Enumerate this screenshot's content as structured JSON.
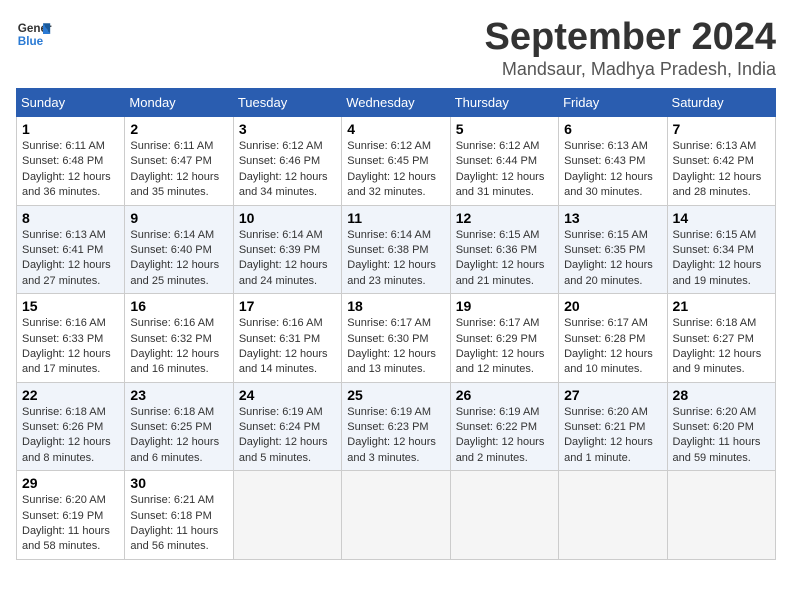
{
  "header": {
    "logo_line1": "General",
    "logo_line2": "Blue",
    "month_title": "September 2024",
    "location": "Mandsaur, Madhya Pradesh, India"
  },
  "weekdays": [
    "Sunday",
    "Monday",
    "Tuesday",
    "Wednesday",
    "Thursday",
    "Friday",
    "Saturday"
  ],
  "weeks": [
    [
      {
        "day": "1",
        "rise": "6:11 AM",
        "set": "6:48 PM",
        "daylight": "12 hours and 36 minutes."
      },
      {
        "day": "2",
        "rise": "6:11 AM",
        "set": "6:47 PM",
        "daylight": "12 hours and 35 minutes."
      },
      {
        "day": "3",
        "rise": "6:12 AM",
        "set": "6:46 PM",
        "daylight": "12 hours and 34 minutes."
      },
      {
        "day": "4",
        "rise": "6:12 AM",
        "set": "6:45 PM",
        "daylight": "12 hours and 32 minutes."
      },
      {
        "day": "5",
        "rise": "6:12 AM",
        "set": "6:44 PM",
        "daylight": "12 hours and 31 minutes."
      },
      {
        "day": "6",
        "rise": "6:13 AM",
        "set": "6:43 PM",
        "daylight": "12 hours and 30 minutes."
      },
      {
        "day": "7",
        "rise": "6:13 AM",
        "set": "6:42 PM",
        "daylight": "12 hours and 28 minutes."
      }
    ],
    [
      {
        "day": "8",
        "rise": "6:13 AM",
        "set": "6:41 PM",
        "daylight": "12 hours and 27 minutes."
      },
      {
        "day": "9",
        "rise": "6:14 AM",
        "set": "6:40 PM",
        "daylight": "12 hours and 25 minutes."
      },
      {
        "day": "10",
        "rise": "6:14 AM",
        "set": "6:39 PM",
        "daylight": "12 hours and 24 minutes."
      },
      {
        "day": "11",
        "rise": "6:14 AM",
        "set": "6:38 PM",
        "daylight": "12 hours and 23 minutes."
      },
      {
        "day": "12",
        "rise": "6:15 AM",
        "set": "6:36 PM",
        "daylight": "12 hours and 21 minutes."
      },
      {
        "day": "13",
        "rise": "6:15 AM",
        "set": "6:35 PM",
        "daylight": "12 hours and 20 minutes."
      },
      {
        "day": "14",
        "rise": "6:15 AM",
        "set": "6:34 PM",
        "daylight": "12 hours and 19 minutes."
      }
    ],
    [
      {
        "day": "15",
        "rise": "6:16 AM",
        "set": "6:33 PM",
        "daylight": "12 hours and 17 minutes."
      },
      {
        "day": "16",
        "rise": "6:16 AM",
        "set": "6:32 PM",
        "daylight": "12 hours and 16 minutes."
      },
      {
        "day": "17",
        "rise": "6:16 AM",
        "set": "6:31 PM",
        "daylight": "12 hours and 14 minutes."
      },
      {
        "day": "18",
        "rise": "6:17 AM",
        "set": "6:30 PM",
        "daylight": "12 hours and 13 minutes."
      },
      {
        "day": "19",
        "rise": "6:17 AM",
        "set": "6:29 PM",
        "daylight": "12 hours and 12 minutes."
      },
      {
        "day": "20",
        "rise": "6:17 AM",
        "set": "6:28 PM",
        "daylight": "12 hours and 10 minutes."
      },
      {
        "day": "21",
        "rise": "6:18 AM",
        "set": "6:27 PM",
        "daylight": "12 hours and 9 minutes."
      }
    ],
    [
      {
        "day": "22",
        "rise": "6:18 AM",
        "set": "6:26 PM",
        "daylight": "12 hours and 8 minutes."
      },
      {
        "day": "23",
        "rise": "6:18 AM",
        "set": "6:25 PM",
        "daylight": "12 hours and 6 minutes."
      },
      {
        "day": "24",
        "rise": "6:19 AM",
        "set": "6:24 PM",
        "daylight": "12 hours and 5 minutes."
      },
      {
        "day": "25",
        "rise": "6:19 AM",
        "set": "6:23 PM",
        "daylight": "12 hours and 3 minutes."
      },
      {
        "day": "26",
        "rise": "6:19 AM",
        "set": "6:22 PM",
        "daylight": "12 hours and 2 minutes."
      },
      {
        "day": "27",
        "rise": "6:20 AM",
        "set": "6:21 PM",
        "daylight": "12 hours and 1 minute."
      },
      {
        "day": "28",
        "rise": "6:20 AM",
        "set": "6:20 PM",
        "daylight": "11 hours and 59 minutes."
      }
    ],
    [
      {
        "day": "29",
        "rise": "6:20 AM",
        "set": "6:19 PM",
        "daylight": "11 hours and 58 minutes."
      },
      {
        "day": "30",
        "rise": "6:21 AM",
        "set": "6:18 PM",
        "daylight": "11 hours and 56 minutes."
      },
      null,
      null,
      null,
      null,
      null
    ]
  ],
  "labels": {
    "sunrise": "Sunrise:",
    "sunset": "Sunset:",
    "daylight": "Daylight:"
  }
}
